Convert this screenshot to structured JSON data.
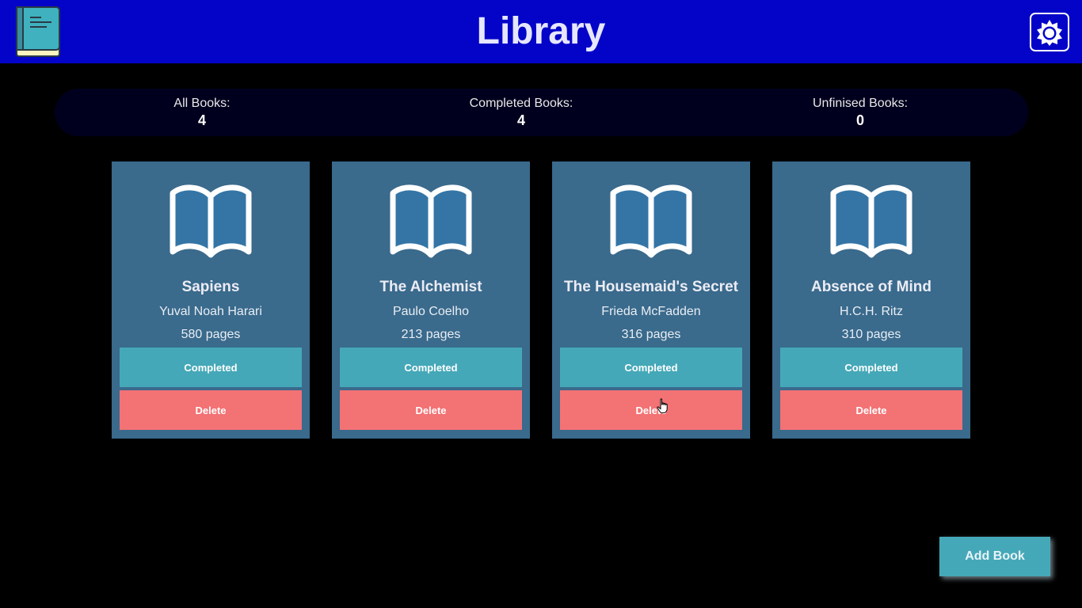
{
  "header": {
    "title": "Library",
    "logo_icon": "book-logo-icon",
    "theme_icon": "sun-icon",
    "background": "#0404c8"
  },
  "stats": {
    "all_label": "All Books:",
    "all_value": "4",
    "completed_label": "Completed Books:",
    "completed_value": "4",
    "unfinished_label": "Unfinised Books:",
    "unfinished_value": "0"
  },
  "books": [
    {
      "title": "Sapiens",
      "author": "Yuval Noah Harari",
      "pages": "580 pages",
      "status_label": "Completed",
      "delete_label": "Delete"
    },
    {
      "title": "The Alchemist",
      "author": "Paulo Coelho",
      "pages": "213 pages",
      "status_label": "Completed",
      "delete_label": "Delete"
    },
    {
      "title": "The Housemaid's Secret",
      "author": "Frieda McFadden",
      "pages": "316 pages",
      "status_label": "Completed",
      "delete_label": "Delete"
    },
    {
      "title": "Absence of Mind",
      "author": "H.C.H. Ritz",
      "pages": "310 pages",
      "status_label": "Completed",
      "delete_label": "Delete"
    }
  ],
  "actions": {
    "add_book_label": "Add Book"
  },
  "colors": {
    "card": "#3a6a8c",
    "completed_button": "#45a8b8",
    "delete_button": "#f37274",
    "add_button": "#45a8b8"
  }
}
